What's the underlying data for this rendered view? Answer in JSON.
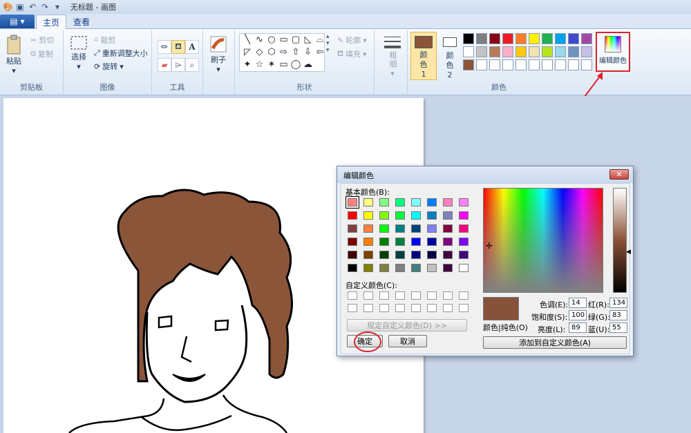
{
  "window": {
    "title": "无标题 - 画图"
  },
  "tabs": {
    "app_menu": "▤ ▾",
    "home": "主页",
    "view": "查看"
  },
  "clipboard": {
    "paste": "粘贴",
    "cut": "剪切",
    "copy": "复制",
    "group": "剪贴板"
  },
  "image": {
    "select": "选择",
    "crop": "裁剪",
    "resize": "重新调整大小",
    "rotate": "旋转",
    "group": "图像"
  },
  "tools": {
    "group": "工具"
  },
  "brushes": {
    "label": "刷子"
  },
  "shapes": {
    "outline": "轮廓",
    "fill": "填充",
    "group": "形状",
    "glyphs": [
      "╲",
      "∿",
      "○",
      "▭",
      "▢",
      "◺",
      "⌓",
      "◸",
      "◇",
      "⬡",
      "⇨",
      "⇧",
      "⇩",
      "⇦",
      "✦",
      "☆",
      "✶",
      "▭",
      "◯",
      "☁"
    ]
  },
  "size": {
    "label": "粗细"
  },
  "colors": {
    "color1": "颜色 1",
    "color2": "颜色 2",
    "edit": "编辑颜色",
    "group": "颜色",
    "color1_value": "#8b553a",
    "color2_value": "#ffffff",
    "palette_row1": [
      "#000000",
      "#7f7f7f",
      "#880015",
      "#ed1c24",
      "#ff7f27",
      "#fff200",
      "#22b14c",
      "#00a2e8",
      "#3f48cc",
      "#a349a4"
    ],
    "palette_row2": [
      "#ffffff",
      "#c3c3c3",
      "#b97a57",
      "#ffaec9",
      "#ffc90e",
      "#efe4b0",
      "#b5e61d",
      "#99d9ea",
      "#7092be",
      "#c8bfe7"
    ],
    "palette_row3": [
      "#8b553a",
      "#ffffff",
      "#ffffff",
      "#ffffff",
      "#ffffff",
      "#ffffff",
      "#ffffff",
      "#ffffff",
      "#ffffff",
      "#ffffff"
    ]
  },
  "dialog": {
    "title": "编辑颜色",
    "close": "✕",
    "basic_colors": "基本颜色(B):",
    "custom_colors": "自定义颜色(C):",
    "define_custom": "规定自定义颜色(D) >>",
    "ok": "确定",
    "cancel": "取消",
    "color_solid": "颜色|纯色(O)",
    "add_custom": "添加到自定义颜色(A)",
    "hue_label": "色调(E):",
    "hue": "14",
    "sat_label": "饱和度(S):",
    "sat": "100",
    "lum_label": "亮度(L):",
    "lum": "89",
    "red_label": "红(R):",
    "red": "134",
    "green_label": "绿(G):",
    "green": "83",
    "blue_label": "蓝(U):",
    "blue": "55",
    "preview_color": "#86533a",
    "basic": [
      [
        "#ff8080",
        "#ffff80",
        "#80ff80",
        "#00ff80",
        "#80ffff",
        "#0080ff",
        "#ff80c0",
        "#ff80ff"
      ],
      [
        "#ff0000",
        "#ffff00",
        "#80ff00",
        "#00ff40",
        "#00ffff",
        "#0080c0",
        "#8080c0",
        "#ff00ff"
      ],
      [
        "#804040",
        "#ff8040",
        "#00ff00",
        "#008080",
        "#004080",
        "#8080ff",
        "#800040",
        "#ff0080"
      ],
      [
        "#800000",
        "#ff8000",
        "#008000",
        "#008040",
        "#0000ff",
        "#0000a0",
        "#800080",
        "#8000ff"
      ],
      [
        "#400000",
        "#804000",
        "#004000",
        "#004040",
        "#000080",
        "#000040",
        "#400040",
        "#400080"
      ],
      [
        "#000000",
        "#808000",
        "#808040",
        "#808080",
        "#408080",
        "#c0c0c0",
        "#400040",
        "#ffffff"
      ]
    ]
  }
}
